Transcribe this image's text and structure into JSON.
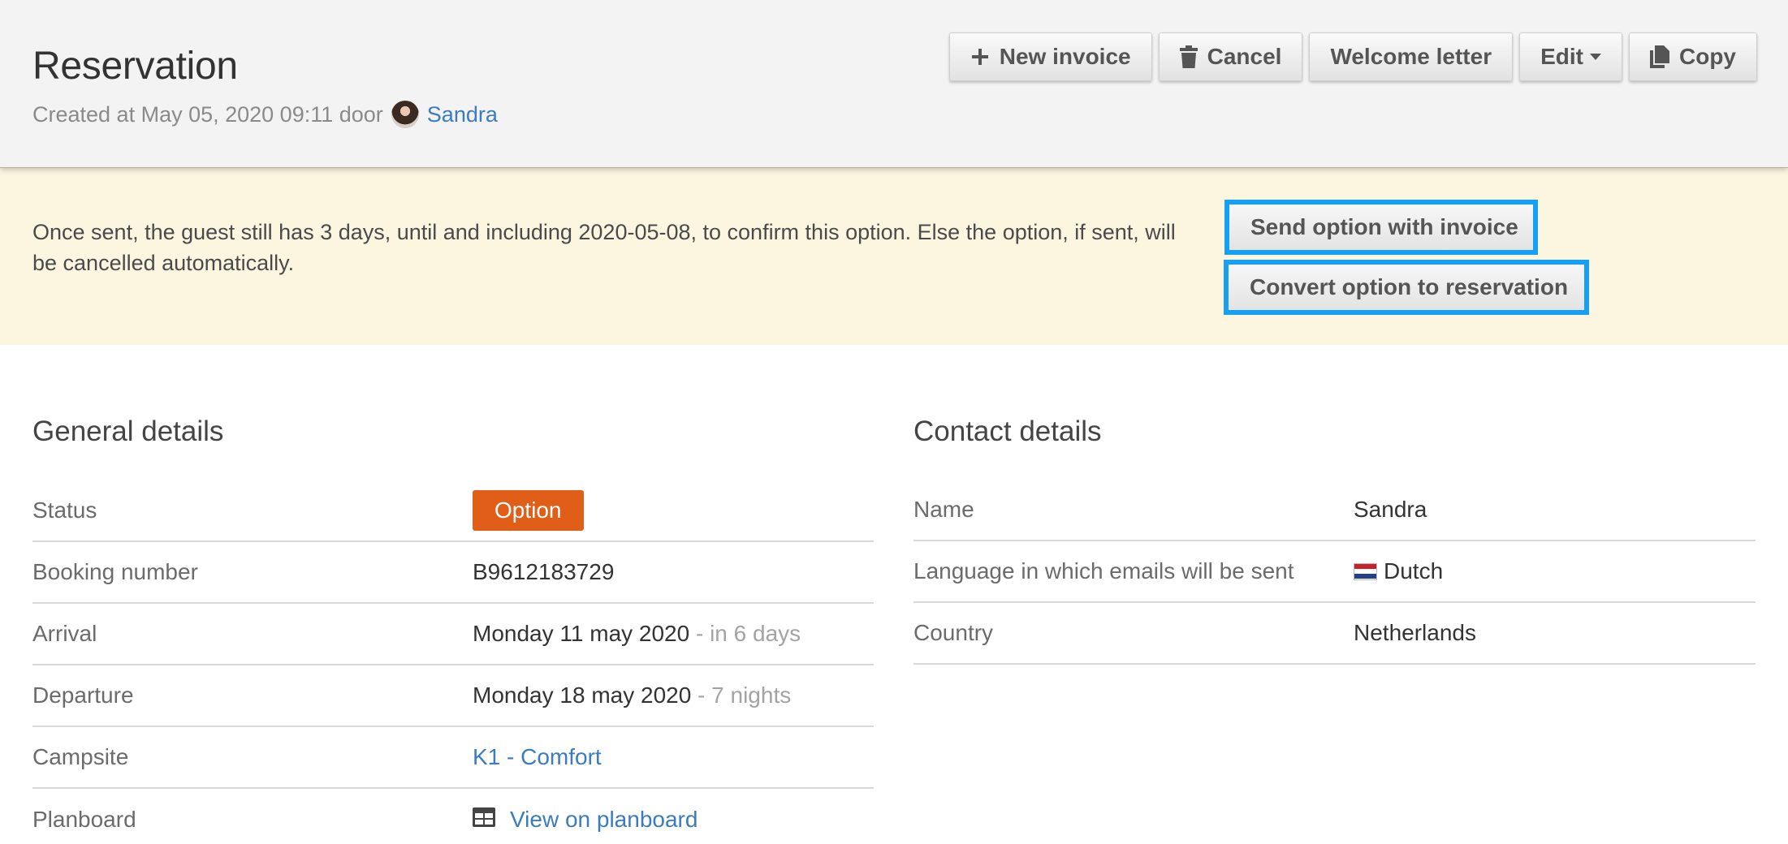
{
  "header": {
    "title": "Reservation",
    "created_prefix": "Created at May 05, 2020 09:11 door",
    "created_by": "Sandra",
    "avatar_icon": "user-avatar"
  },
  "toolbar": {
    "new_invoice": "New invoice",
    "cancel": "Cancel",
    "welcome_letter": "Welcome letter",
    "edit": "Edit",
    "copy": "Copy"
  },
  "notice": {
    "text": "Once sent, the guest still has 3 days, until and including 2020-05-08, to confirm this option. Else the option, if sent, will be cancelled automatically.",
    "send_button": "Send option with invoice",
    "convert_button": "Convert option to reservation",
    "highlight_color": "#15a0f3"
  },
  "general": {
    "title": "General details",
    "status_label": "Status",
    "status_value": "Option",
    "status_color": "#e15e18",
    "booking_label": "Booking number",
    "booking_value": "B9612183729",
    "arrival_label": "Arrival",
    "arrival_value": "Monday 11 may 2020",
    "arrival_note": " - in 6 days",
    "departure_label": "Departure",
    "departure_value": "Monday 18 may 2020",
    "departure_note": " - 7 nights",
    "campsite_label": "Campsite",
    "campsite_value": "K1 - Comfort",
    "planboard_label": "Planboard",
    "planboard_value": "View on planboard"
  },
  "contact": {
    "title": "Contact details",
    "name_label": "Name",
    "name_value": "Sandra",
    "language_label": "Language in which emails will be sent",
    "language_value": "Dutch",
    "language_flag": "netherlands-flag",
    "country_label": "Country",
    "country_value": "Netherlands"
  }
}
